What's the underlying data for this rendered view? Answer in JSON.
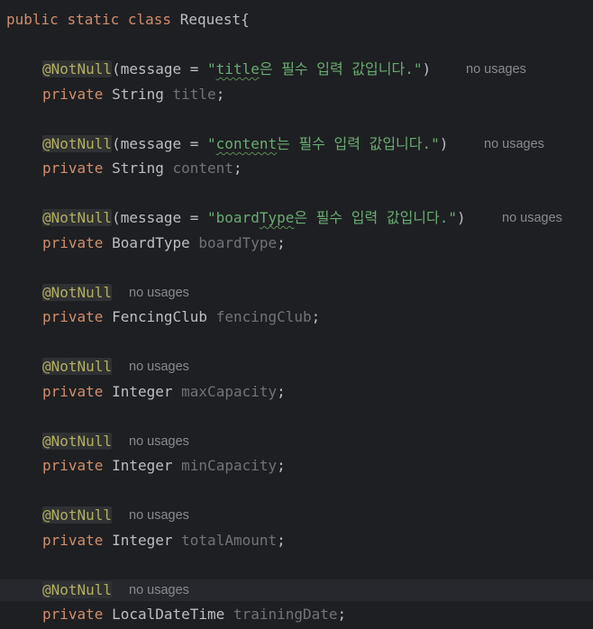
{
  "class_decl": {
    "kw_public": "public",
    "kw_static": "static",
    "kw_class": "class",
    "name": "Request",
    "brace": "{"
  },
  "fields": [
    {
      "annotation": "@NotNull",
      "args_open": "(message = ",
      "msg_prefix": "\"",
      "msg_word": "title",
      "msg_rest": "은 필수 입력 값입니다.\"",
      "args_close": ")",
      "hint": "no usages",
      "modifier": "private",
      "type": "String",
      "name": "title",
      "semi": ";"
    },
    {
      "annotation": "@NotNull",
      "args_open": "(message = ",
      "msg_prefix": "\"",
      "msg_word": "content",
      "msg_rest": "는 필수 입력 값입니다.\"",
      "args_close": ")",
      "hint": "no usages",
      "modifier": "private",
      "type": "String",
      "name": "content",
      "semi": ";"
    },
    {
      "annotation": "@NotNull",
      "args_open": "(message = ",
      "msg_prefix": "\"board",
      "msg_word": "Type",
      "msg_rest": "은 필수 입력 값입니다.\"",
      "args_close": ")",
      "hint": "no usages",
      "modifier": "private",
      "type": "BoardType",
      "name": "boardType",
      "semi": ";"
    },
    {
      "annotation": "@NotNull",
      "hint": "no usages",
      "modifier": "private",
      "type": "FencingClub",
      "name": "fencingClub",
      "semi": ";"
    },
    {
      "annotation": "@NotNull",
      "hint": "no usages",
      "modifier": "private",
      "type": "Integer",
      "name": "maxCapacity",
      "semi": ";"
    },
    {
      "annotation": "@NotNull",
      "hint": "no usages",
      "modifier": "private",
      "type": "Integer",
      "name": "minCapacity",
      "semi": ";"
    },
    {
      "annotation": "@NotNull",
      "hint": "no usages",
      "modifier": "private",
      "type": "Integer",
      "name": "totalAmount",
      "semi": ";"
    },
    {
      "annotation": "@NotNull",
      "hint": "no usages",
      "modifier": "private",
      "type": "LocalDateTime",
      "name": "trainingDate",
      "semi": ";"
    }
  ]
}
